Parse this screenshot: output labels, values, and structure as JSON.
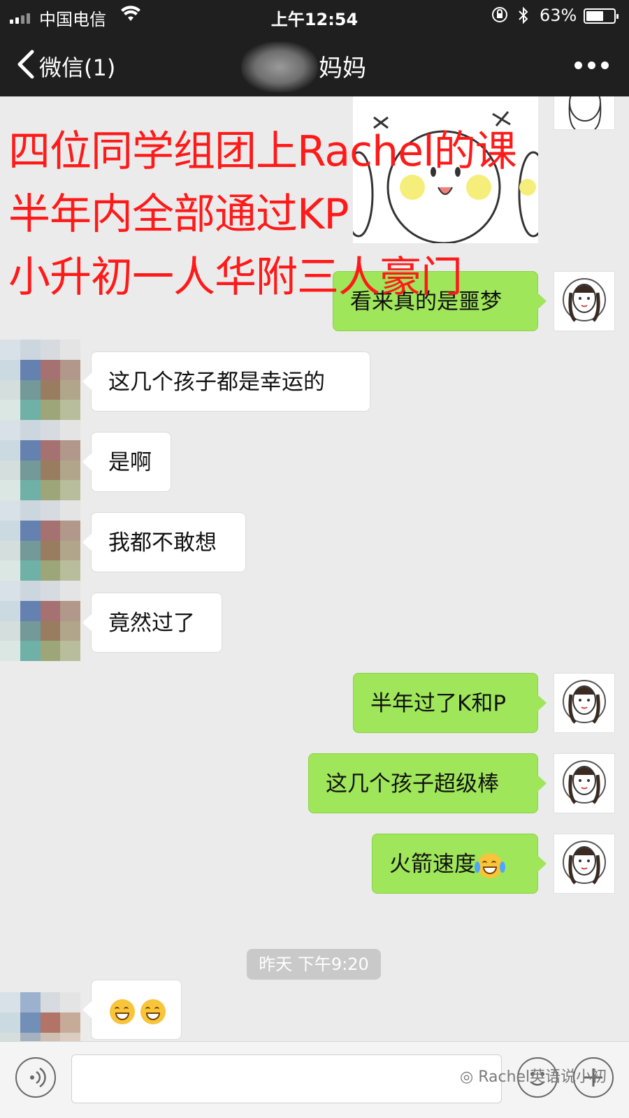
{
  "status_bar": {
    "carrier": "中国电信",
    "time": "上午12:54",
    "battery_percent": "63%",
    "battery_level": 0.63
  },
  "nav": {
    "back_label": "微信(1)",
    "title": "妈妈"
  },
  "overlay_text": [
    "四位同学组团上Rachel的课",
    "半年内全部通过KP",
    "小升初一人华附三人豪门"
  ],
  "messages": [
    {
      "side": "me",
      "text": "看来真的是噩梦"
    },
    {
      "side": "other",
      "text": "这几个孩子都是幸运的"
    },
    {
      "side": "other",
      "text": "是啊"
    },
    {
      "side": "other",
      "text": "我都不敢想"
    },
    {
      "side": "other",
      "text": "竟然过了"
    },
    {
      "side": "me",
      "text": "半年过了K和P"
    },
    {
      "side": "me",
      "text": "这几个孩子超级棒"
    },
    {
      "side": "me",
      "text": "火箭速度"
    },
    {
      "side": "other",
      "text": ""
    }
  ],
  "timestamp": "昨天 下午9:20",
  "watermark": "Rachel英语说小初",
  "colors": {
    "my_bubble": "#9fe65a",
    "other_bubble": "#ffffff",
    "overlay_red": "#ff1a1a",
    "nav_bg": "#1f1f1f"
  },
  "icons": [
    "back-chevron-icon",
    "more-icon",
    "wifi-icon",
    "bluetooth-icon",
    "rotation-lock-icon",
    "voice-icon",
    "emoji-icon",
    "plus-icon",
    "tears-of-joy-emoji",
    "grinning-emoji"
  ]
}
